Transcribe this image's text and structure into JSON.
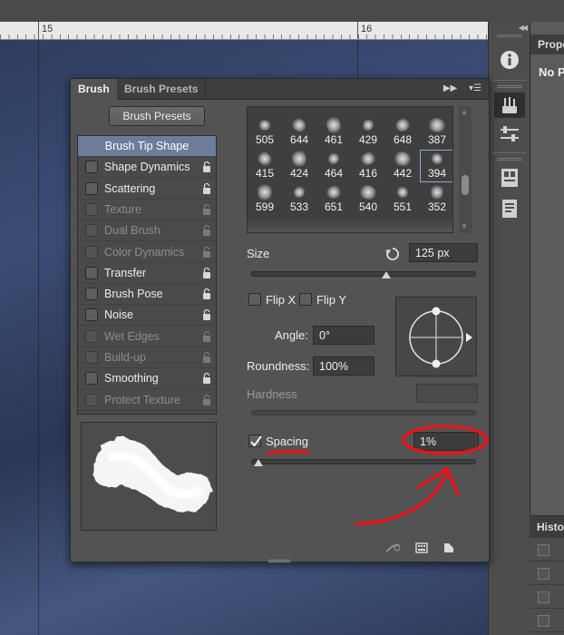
{
  "ruler": {
    "labels": [
      "15",
      "16"
    ]
  },
  "dock": {
    "properties_header": "Prope",
    "properties_text": "No P",
    "history_header": "Histo"
  },
  "panel": {
    "tabs": [
      {
        "label": "Brush",
        "active": true
      },
      {
        "label": "Brush Presets",
        "active": false
      }
    ],
    "presets_button": "Brush Presets",
    "options": [
      {
        "label": "Brush Tip Shape",
        "state": "selected",
        "lock": false
      },
      {
        "label": "Shape Dynamics",
        "state": "enabled",
        "lock": true
      },
      {
        "label": "Scattering",
        "state": "enabled",
        "lock": true
      },
      {
        "label": "Texture",
        "state": "disabled",
        "lock": true
      },
      {
        "label": "Dual Brush",
        "state": "disabled",
        "lock": true
      },
      {
        "label": "Color Dynamics",
        "state": "disabled",
        "lock": true
      },
      {
        "label": "Transfer",
        "state": "enabled",
        "lock": true
      },
      {
        "label": "Brush Pose",
        "state": "enabled",
        "lock": true
      },
      {
        "label": "Noise",
        "state": "enabled",
        "lock": true
      },
      {
        "label": "Wet Edges",
        "state": "disabled",
        "lock": true
      },
      {
        "label": "Build-up",
        "state": "disabled",
        "lock": true
      },
      {
        "label": "Smoothing",
        "state": "enabled",
        "lock": true
      },
      {
        "label": "Protect Texture",
        "state": "disabled",
        "lock": true
      }
    ],
    "tips": {
      "rows": [
        [
          "505",
          "644",
          "461",
          "429",
          "648",
          "387"
        ],
        [
          "415",
          "424",
          "464",
          "416",
          "442",
          "394"
        ],
        [
          "599",
          "533",
          "651",
          "540",
          "551",
          "352"
        ]
      ],
      "selected": "394"
    },
    "size": {
      "label": "Size",
      "value": "125 px",
      "slider": 0.6
    },
    "flip_x": {
      "label": "Flip X",
      "checked": false
    },
    "flip_y": {
      "label": "Flip Y",
      "checked": false
    },
    "angle": {
      "label": "Angle:",
      "value": "0°"
    },
    "roundness": {
      "label": "Roundness:",
      "value": "100%"
    },
    "hardness": {
      "label": "Hardness"
    },
    "spacing": {
      "label": "Spacing",
      "checked": true,
      "value": "1%",
      "slider": 0.01
    }
  },
  "colors": {
    "annotation": "#e8141a",
    "selected_row": "#6c7d9c",
    "panel_bg": "#535353"
  }
}
